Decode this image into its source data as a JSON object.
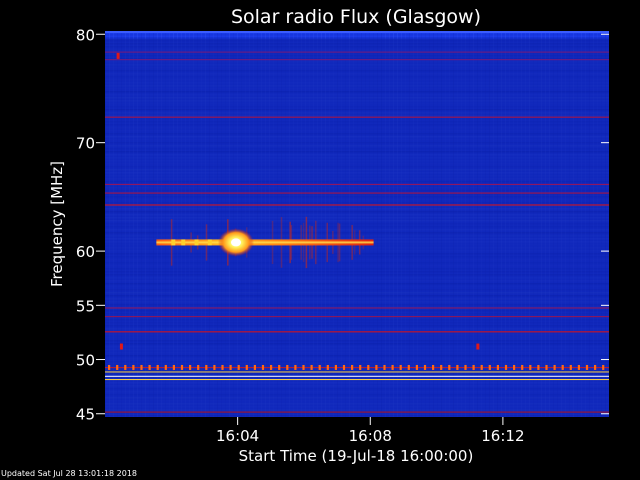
{
  "footer": {
    "updated": "Updated Sat Jul 28 13:01:18 2018"
  },
  "chart_data": {
    "type": "heatmap",
    "title": "Solar radio Flux (Glasgow)",
    "xlabel": "Start Time (19-Jul-18 16:00:00)",
    "ylabel": "Frequency [MHz]",
    "x_unit": "minutes after 16:00",
    "xlim": [
      0,
      15.2
    ],
    "ylim": [
      80.3,
      44.7
    ],
    "y_inverted": true,
    "x_ticks": [
      {
        "value": 4,
        "label": "16:04"
      },
      {
        "value": 8,
        "label": "16:08"
      },
      {
        "value": 12,
        "label": "16:12"
      }
    ],
    "y_ticks": [
      {
        "value": 45,
        "label": "45"
      },
      {
        "value": 50,
        "label": "50"
      },
      {
        "value": 55,
        "label": "55"
      },
      {
        "value": 60,
        "label": "60"
      },
      {
        "value": 70,
        "label": "70"
      },
      {
        "value": 80,
        "label": "80"
      }
    ],
    "colors": {
      "background": "#000000",
      "low": "#1a3ae6",
      "mid": "#c81414",
      "high": "#ffe64a",
      "max": "#ffffff",
      "text": "#ffffff"
    },
    "bands": [
      {
        "freq_start": 45.2,
        "freq_end": 45.5,
        "intensity": "mid",
        "color": "#b3121e"
      },
      {
        "freq_start": 48.2,
        "freq_end": 48.5,
        "intensity": "high",
        "color": "#ffd23c"
      },
      {
        "freq_start": 48.5,
        "freq_end": 48.9,
        "intensity": "max",
        "color": "#ffffff"
      },
      {
        "freq_start": 48.9,
        "freq_end": 49.2,
        "intensity": "high",
        "color": "#ffd23c"
      },
      {
        "freq_start": 49.3,
        "freq_end": 49.8,
        "intensity": "mid",
        "color": "#d01818"
      },
      {
        "freq_start": 52.6,
        "freq_end": 53.0,
        "intensity": "mid",
        "color": "#e01010"
      },
      {
        "freq_start": 54.0,
        "freq_end": 54.4,
        "intensity": "mid",
        "color": "#a0144a"
      },
      {
        "freq_start": 54.8,
        "freq_end": 55.1,
        "intensity": "mid",
        "color": "#9a1456"
      },
      {
        "freq_start": 64.3,
        "freq_end": 64.8,
        "intensity": "mid",
        "color": "#e61010"
      },
      {
        "freq_start": 65.4,
        "freq_end": 65.8,
        "intensity": "mid",
        "color": "#b8123a"
      },
      {
        "freq_start": 66.2,
        "freq_end": 66.6,
        "intensity": "mid",
        "color": "#a01454"
      },
      {
        "freq_start": 72.4,
        "freq_end": 72.8,
        "intensity": "mid",
        "color": "#b8123a"
      },
      {
        "freq_start": 77.7,
        "freq_end": 78.0,
        "intensity": "mid",
        "color": "#7a1a7a"
      },
      {
        "freq_start": 78.4,
        "freq_end": 78.7,
        "intensity": "mid",
        "color": "#7a1a7a"
      }
    ],
    "events": [
      {
        "label": "burst",
        "t_start": 1.55,
        "t_end": 8.1,
        "freq": 60.8,
        "peak_t": 3.95,
        "peak_freq": 60.8
      }
    ]
  }
}
